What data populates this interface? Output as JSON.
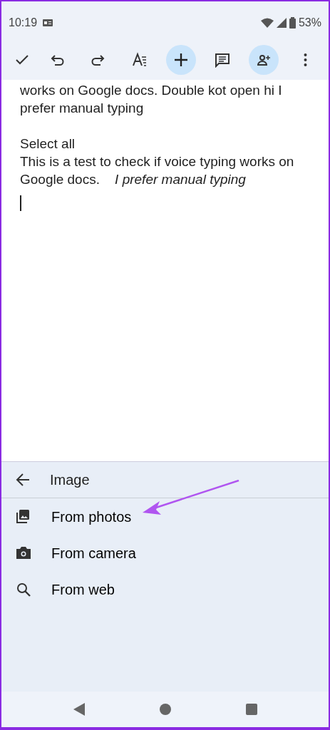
{
  "status_bar": {
    "time": "10:19",
    "battery": "53%"
  },
  "toolbar": {
    "buttons": [
      {
        "kind": "check",
        "highlighted": false
      },
      {
        "kind": "undo",
        "highlighted": false
      },
      {
        "kind": "redo",
        "highlighted": false
      },
      {
        "kind": "format",
        "highlighted": false
      },
      {
        "kind": "insert",
        "highlighted": true
      },
      {
        "kind": "comment",
        "highlighted": false
      },
      {
        "kind": "share",
        "highlighted": true
      },
      {
        "kind": "more",
        "highlighted": false
      }
    ]
  },
  "document": {
    "paragraphs": [
      {
        "text": "works on Google docs. Double kot open hi I"
      },
      {
        "text": "prefer manual typing"
      },
      {
        "text": "Select all",
        "space_before": true
      },
      {
        "text": "This is a test to check if voice typing works on Google docs.    *I prefer manual typing*"
      }
    ]
  },
  "sheet": {
    "title": "Image",
    "items": [
      {
        "kind": "photos",
        "label": "From photos"
      },
      {
        "kind": "camera",
        "label": "From camera"
      },
      {
        "kind": "web",
        "label": "From web"
      }
    ]
  }
}
